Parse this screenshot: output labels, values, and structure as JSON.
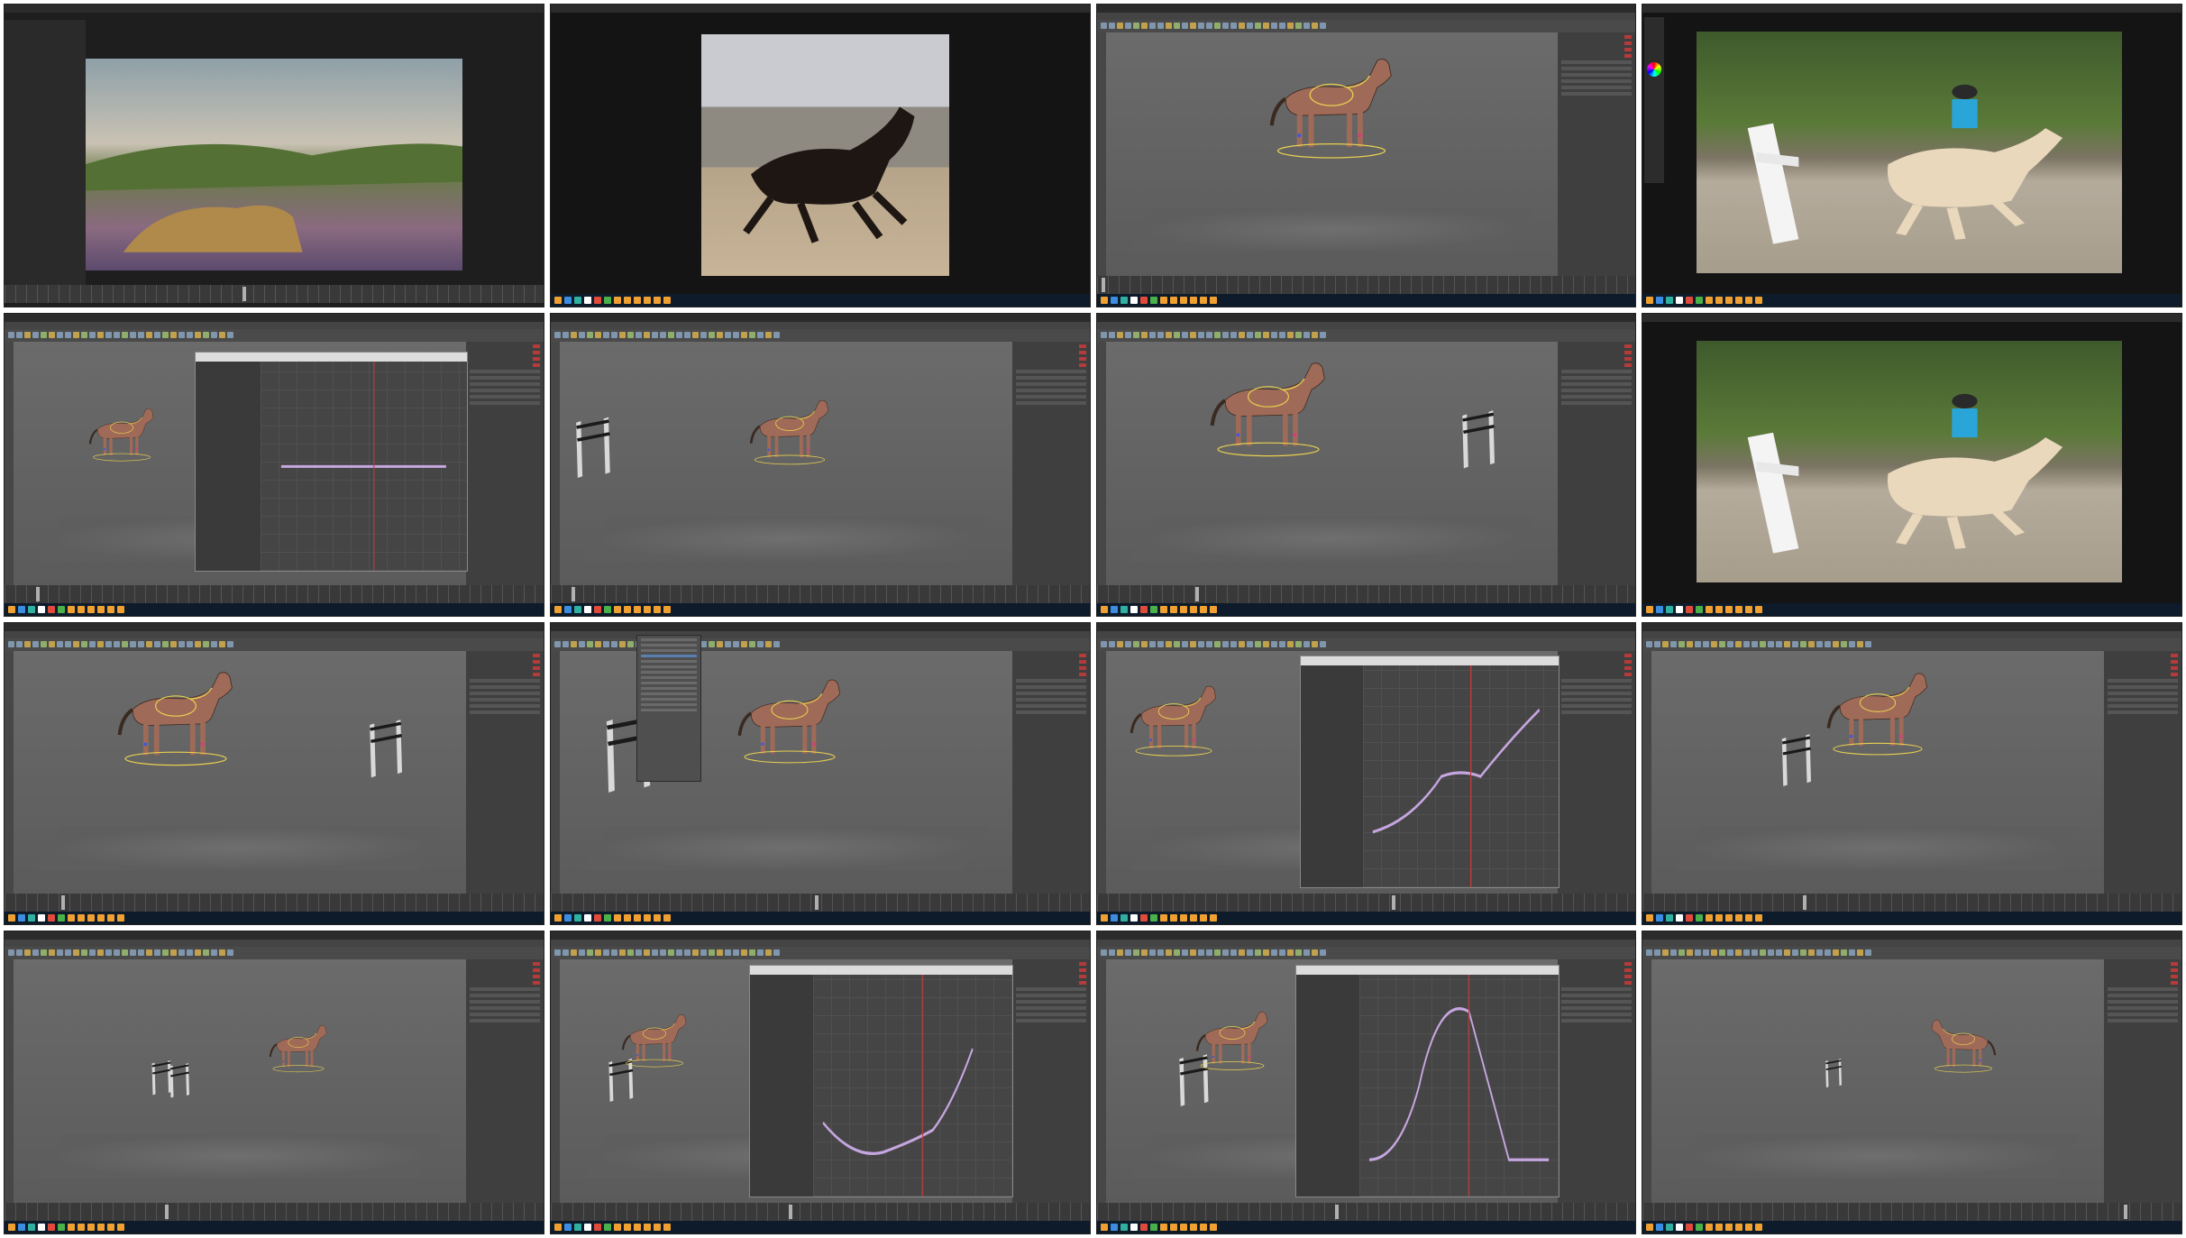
{
  "grid": {
    "rows": 4,
    "columns": 4
  },
  "tiles": [
    {
      "kind": "browser-3d-scene",
      "scene": "leopard-landscape",
      "timeline_position": 0.45
    },
    {
      "kind": "video-player",
      "scene": "horse-running-arena"
    },
    {
      "kind": "maya",
      "scene": "horse-rig-standing",
      "timeline_position": 0.0
    },
    {
      "kind": "paint-video",
      "scene": "horse-jump-photo"
    },
    {
      "kind": "maya-graph",
      "scene": "horse-rig-small",
      "timeline_position": 0.05
    },
    {
      "kind": "maya",
      "scene": "horse-rig-fence-left",
      "timeline_position": 0.03
    },
    {
      "kind": "maya",
      "scene": "horse-rig-walk-fence-right",
      "timeline_position": 0.18
    },
    {
      "kind": "video-player",
      "scene": "horse-jump-photo"
    },
    {
      "kind": "maya",
      "scene": "horse-rig-walk-fence-right",
      "timeline_position": 0.1
    },
    {
      "kind": "maya-menu",
      "scene": "horse-rig-leap-fence",
      "timeline_position": 0.5
    },
    {
      "kind": "maya-graph",
      "scene": "horse-rig-walk-graph",
      "timeline_position": 0.56
    },
    {
      "kind": "maya",
      "scene": "horse-rig-jump-fence",
      "timeline_position": 0.3
    },
    {
      "kind": "maya",
      "scene": "horse-rig-far-fences",
      "timeline_position": 0.3
    },
    {
      "kind": "maya-graph",
      "scene": "horse-rig-jump-graph",
      "timeline_position": 0.45
    },
    {
      "kind": "maya-graph",
      "scene": "horse-rig-jump-graph-2",
      "timeline_position": 0.45
    },
    {
      "kind": "maya",
      "scene": "horse-rig-walk-far",
      "timeline_position": 0.92
    }
  ]
}
